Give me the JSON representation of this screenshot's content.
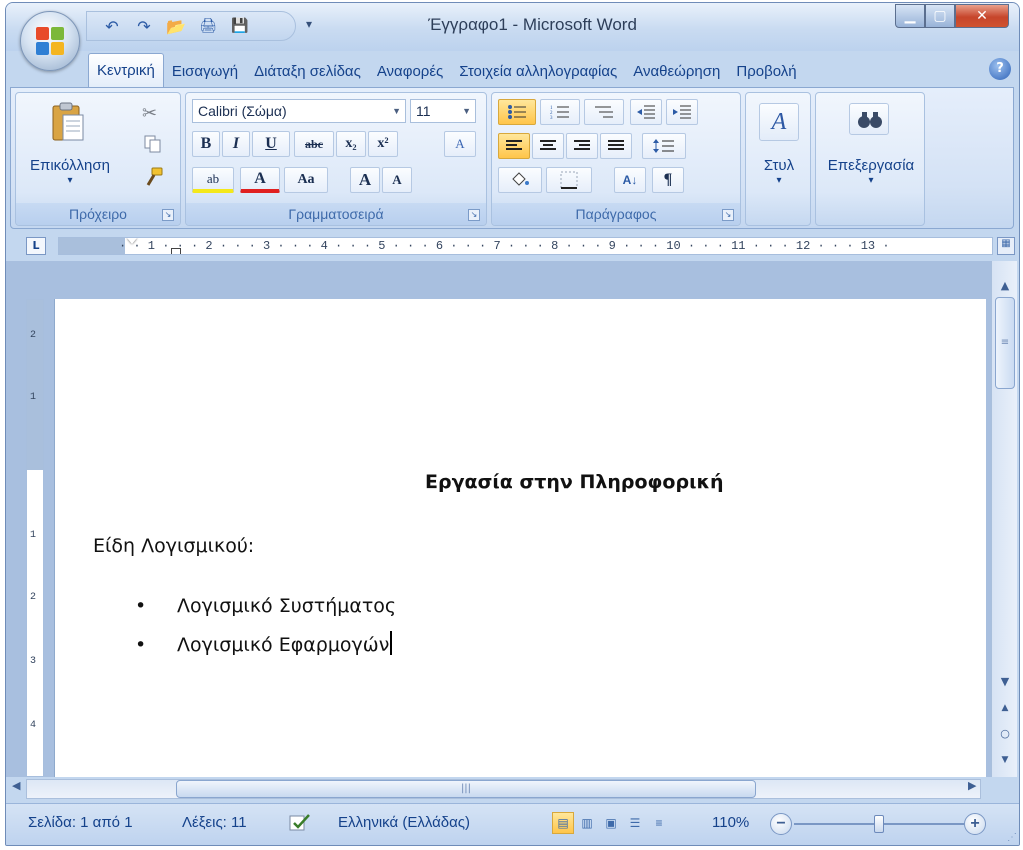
{
  "window": {
    "title": "Έγγραφο1 - Microsoft Word",
    "minimize": "▁",
    "maximize": "▢",
    "close": "✕"
  },
  "quick_access": {
    "undo": "↶",
    "redo": "↷",
    "open": "📂",
    "print": "🖨",
    "save": "💾",
    "more": "▾"
  },
  "tabs": [
    "Κεντρική",
    "Εισαγωγή",
    "Διάταξη σελίδας",
    "Αναφορές",
    "Στοιχεία αλληλογραφίας",
    "Αναθεώρηση",
    "Προβολή"
  ],
  "active_tab": "Κεντρική",
  "help": "?",
  "ribbon": {
    "clipboard": {
      "label": "Πρόχειρο",
      "paste_label": "Επικόλληση",
      "paste_arrow": "▾"
    },
    "font": {
      "label": "Γραμματοσειρά",
      "font_name": "Calibri (Σώμα)",
      "font_size": "11",
      "bold": "B",
      "italic": "I",
      "underline": "U",
      "strike": "abc",
      "subscript": "x₂",
      "superscript": "x²",
      "clear": "A",
      "highlight": "ab",
      "color": "A",
      "case": "Aa",
      "grow": "A",
      "shrink": "A"
    },
    "paragraph": {
      "label": "Παράγραφος",
      "pilcrow": "¶",
      "sort": "A↓"
    },
    "styles": {
      "label": "Στυλ"
    },
    "editing": {
      "label": "Επεξεργασία"
    }
  },
  "ruler": {
    "numbers": "· · 1 · · · 2 · · · 3 · · · 4 · · · 5 · · · 6 · · · 7 · · · 8 · · · 9 · · · 10 · · · 11 · · · 12 · · · 13 ·",
    "tab_selector": "L"
  },
  "document": {
    "title": "Εργασία στην Πληροφορική",
    "heading": "Είδη Λογισμικού:",
    "bullets": [
      "Λογισμικό Συστήματος",
      "Λογισμικό Εφαρμογών"
    ],
    "bullet_symbol": "•"
  },
  "status": {
    "page": "Σελίδα: 1 από 1",
    "words": "Λέξεις: 11",
    "language": "Ελληνικά (Ελλάδας)",
    "zoom": "110%",
    "zoom_minus": "−",
    "zoom_plus": "+"
  }
}
